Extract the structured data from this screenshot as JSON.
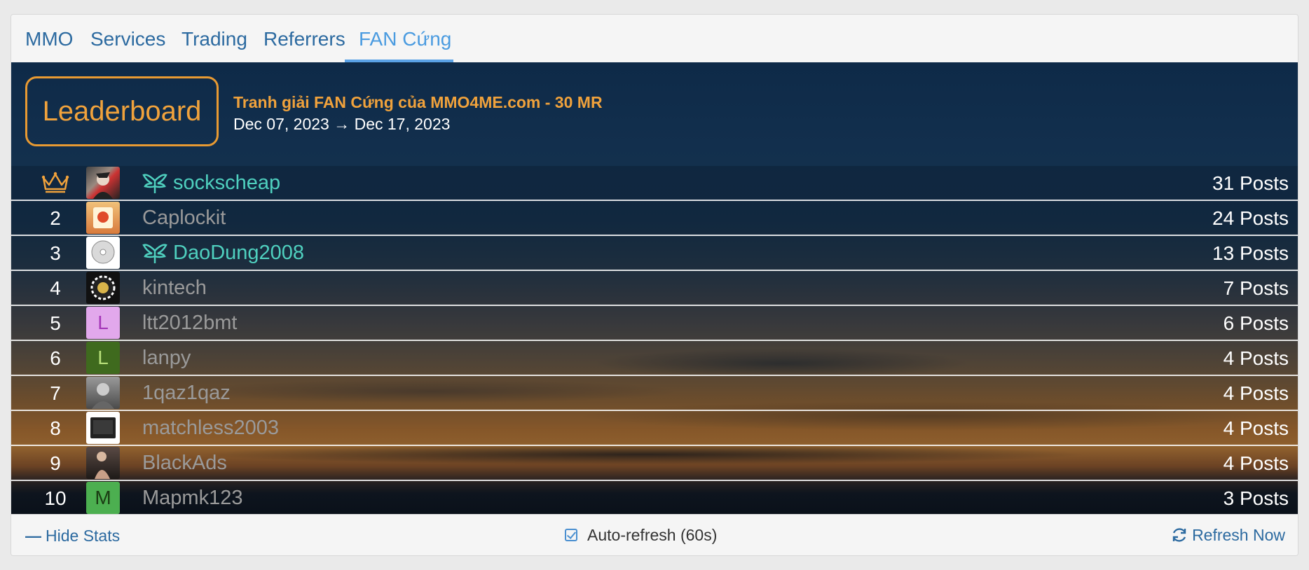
{
  "tabs": [
    {
      "label": "MMO"
    },
    {
      "label": "Services"
    },
    {
      "label": "Trading"
    },
    {
      "label": "Referrers"
    },
    {
      "label": "FAN Cứng",
      "active": true
    }
  ],
  "leaderboard": {
    "badge": "Leaderboard",
    "title": "Tranh giải FAN Cứng của MMO4ME.com - 30 MR",
    "dates": "Dec 07, 2023 → Dec 17, 2023",
    "rows": [
      {
        "rank": "1",
        "rank_icon": "crown-icon",
        "username": "sockscheap",
        "vip": true,
        "posts": "31 Posts"
      },
      {
        "rank": "2",
        "username": "Caplockit",
        "vip": false,
        "posts": "24 Posts"
      },
      {
        "rank": "3",
        "username": "DaoDung2008",
        "vip": true,
        "posts": "13 Posts"
      },
      {
        "rank": "4",
        "username": "kintech",
        "vip": false,
        "posts": "7 Posts"
      },
      {
        "rank": "5",
        "username": "ltt2012bmt",
        "vip": false,
        "posts": "6 Posts",
        "avatar_letter": "L"
      },
      {
        "rank": "6",
        "username": "lanpy",
        "vip": false,
        "posts": "4 Posts",
        "avatar_letter": "L"
      },
      {
        "rank": "7",
        "username": "1qaz1qaz",
        "vip": false,
        "posts": "4 Posts"
      },
      {
        "rank": "8",
        "username": "matchless2003",
        "vip": false,
        "posts": "4 Posts"
      },
      {
        "rank": "9",
        "username": "BlackAds",
        "vip": false,
        "posts": "4 Posts"
      },
      {
        "rank": "10",
        "username": "Mapmk123",
        "vip": false,
        "posts": "3 Posts",
        "avatar_letter": "M"
      }
    ]
  },
  "footer": {
    "hide_stats": "Hide Stats",
    "auto_refresh": "Auto-refresh (60s)",
    "auto_refresh_checked": true,
    "refresh_now": "Refresh Now"
  },
  "colors": {
    "accent": "#2c6aa0",
    "active_tab": "#4a9be0",
    "highlight_orange": "#f0a23c",
    "vip_name": "#4fd0bf",
    "normal_name": "#9a9a9a"
  }
}
